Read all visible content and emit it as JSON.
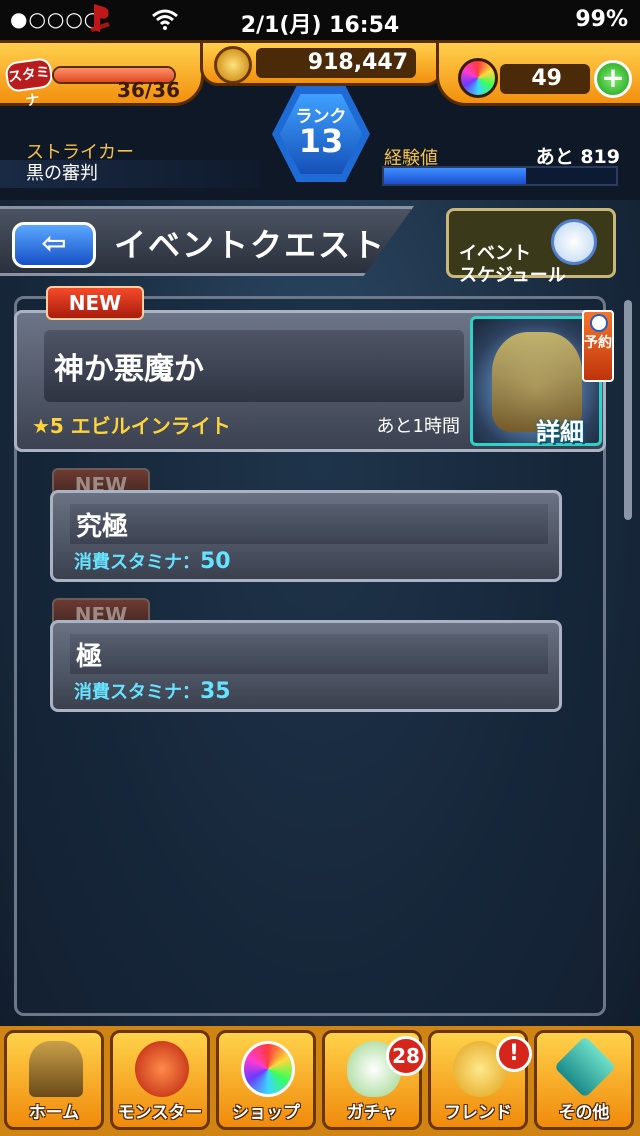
{
  "status_bar": {
    "signal": "●○○○○",
    "time": "2/1(月) 16:54",
    "battery": "99%"
  },
  "header": {
    "stamina_label": "スタミナ",
    "stamina_value": "36/36",
    "stamina_fraction": 1.0,
    "coins": "918,447",
    "orbs": "49",
    "plus": "+",
    "rank_label": "ランク",
    "rank_value": "13",
    "job": "ストライカー",
    "job_title": "黒の審判",
    "exp_label": "経験値",
    "exp_remaining": "あと 819",
    "exp_fraction": 0.61
  },
  "title_bar": {
    "back": "⇦",
    "title": "イベントクエスト",
    "schedule_button": "イベント\nスケジュール"
  },
  "quest": {
    "new_badge": "NEW",
    "title": "神か悪魔か",
    "subtitle": "★5 エビルインライト",
    "time_left": "あと1時間",
    "reserve": "予約",
    "detail": "詳細"
  },
  "sub_quests": [
    {
      "badge": "NEW",
      "title": "究極",
      "cost_label": "消費スタミナ：",
      "cost": "50"
    },
    {
      "badge": "NEW",
      "title": "極",
      "cost_label": "消費スタミナ：",
      "cost": "35"
    }
  ],
  "nav": [
    {
      "label": "ホーム",
      "icon": "home-gate-icon"
    },
    {
      "label": "モンスター",
      "icon": "monster-icon"
    },
    {
      "label": "ショップ",
      "icon": "orb-icon"
    },
    {
      "label": "ガチャ",
      "icon": "egg-icon",
      "badge": "28"
    },
    {
      "label": "フレンド",
      "icon": "friends-icon",
      "badge": "!"
    },
    {
      "label": "その他",
      "icon": "other-icon"
    }
  ]
}
